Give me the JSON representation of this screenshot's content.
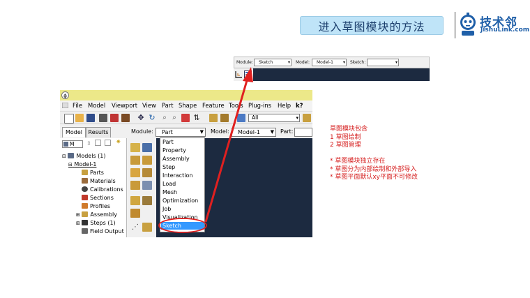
{
  "slide": {
    "title": "进入草图模块的方法"
  },
  "logo": {
    "name": "技术邻",
    "subtitle": "JishuLink.com"
  },
  "top_toolbar": {
    "module_label": "Module:",
    "module_value": "Sketch",
    "model_label": "Model:",
    "model_value": "Model-1",
    "sketch_label": "Sketch:",
    "sketch_value": ""
  },
  "menu": {
    "items": [
      "File",
      "Model",
      "Viewport",
      "View",
      "Part",
      "Shape",
      "Feature",
      "Tools",
      "Plug-ins",
      "Help",
      "k?"
    ]
  },
  "toolbar": {
    "filter_value": "All"
  },
  "tabs": [
    "Model",
    "Results"
  ],
  "context": {
    "module_label": "Module:",
    "module_value": "Part",
    "model_label": "Model:",
    "model_value": "Model-1",
    "part_label": "Part:",
    "part_value": ""
  },
  "tree": {
    "filter": "M",
    "items": [
      "Models (1)",
      "Model-1",
      "Parts",
      "Materials",
      "Calibrations",
      "Sections",
      "Profiles",
      "Assembly",
      "Steps (1)",
      "Field Output"
    ]
  },
  "dropdown": {
    "items": [
      "Part",
      "Property",
      "Assembly",
      "Step",
      "Interaction",
      "Load",
      "Mesh",
      "Optimization",
      "Job",
      "Visualization"
    ],
    "selected": "Sketch"
  },
  "notes": {
    "lines": [
      "草图模块包含",
      "1 草图绘制",
      "2 草图管理",
      "",
      "* 草图模块独立存在",
      "* 草图分为内部绘制和外部导入",
      "* 草图平面默认xy平面不可修改"
    ]
  },
  "colors": {
    "banner": "#bfe4f8",
    "viewport": "#1c2a40",
    "highlight": "#3399ff",
    "annotation": "#e02020",
    "title_strip": "#ece889"
  }
}
